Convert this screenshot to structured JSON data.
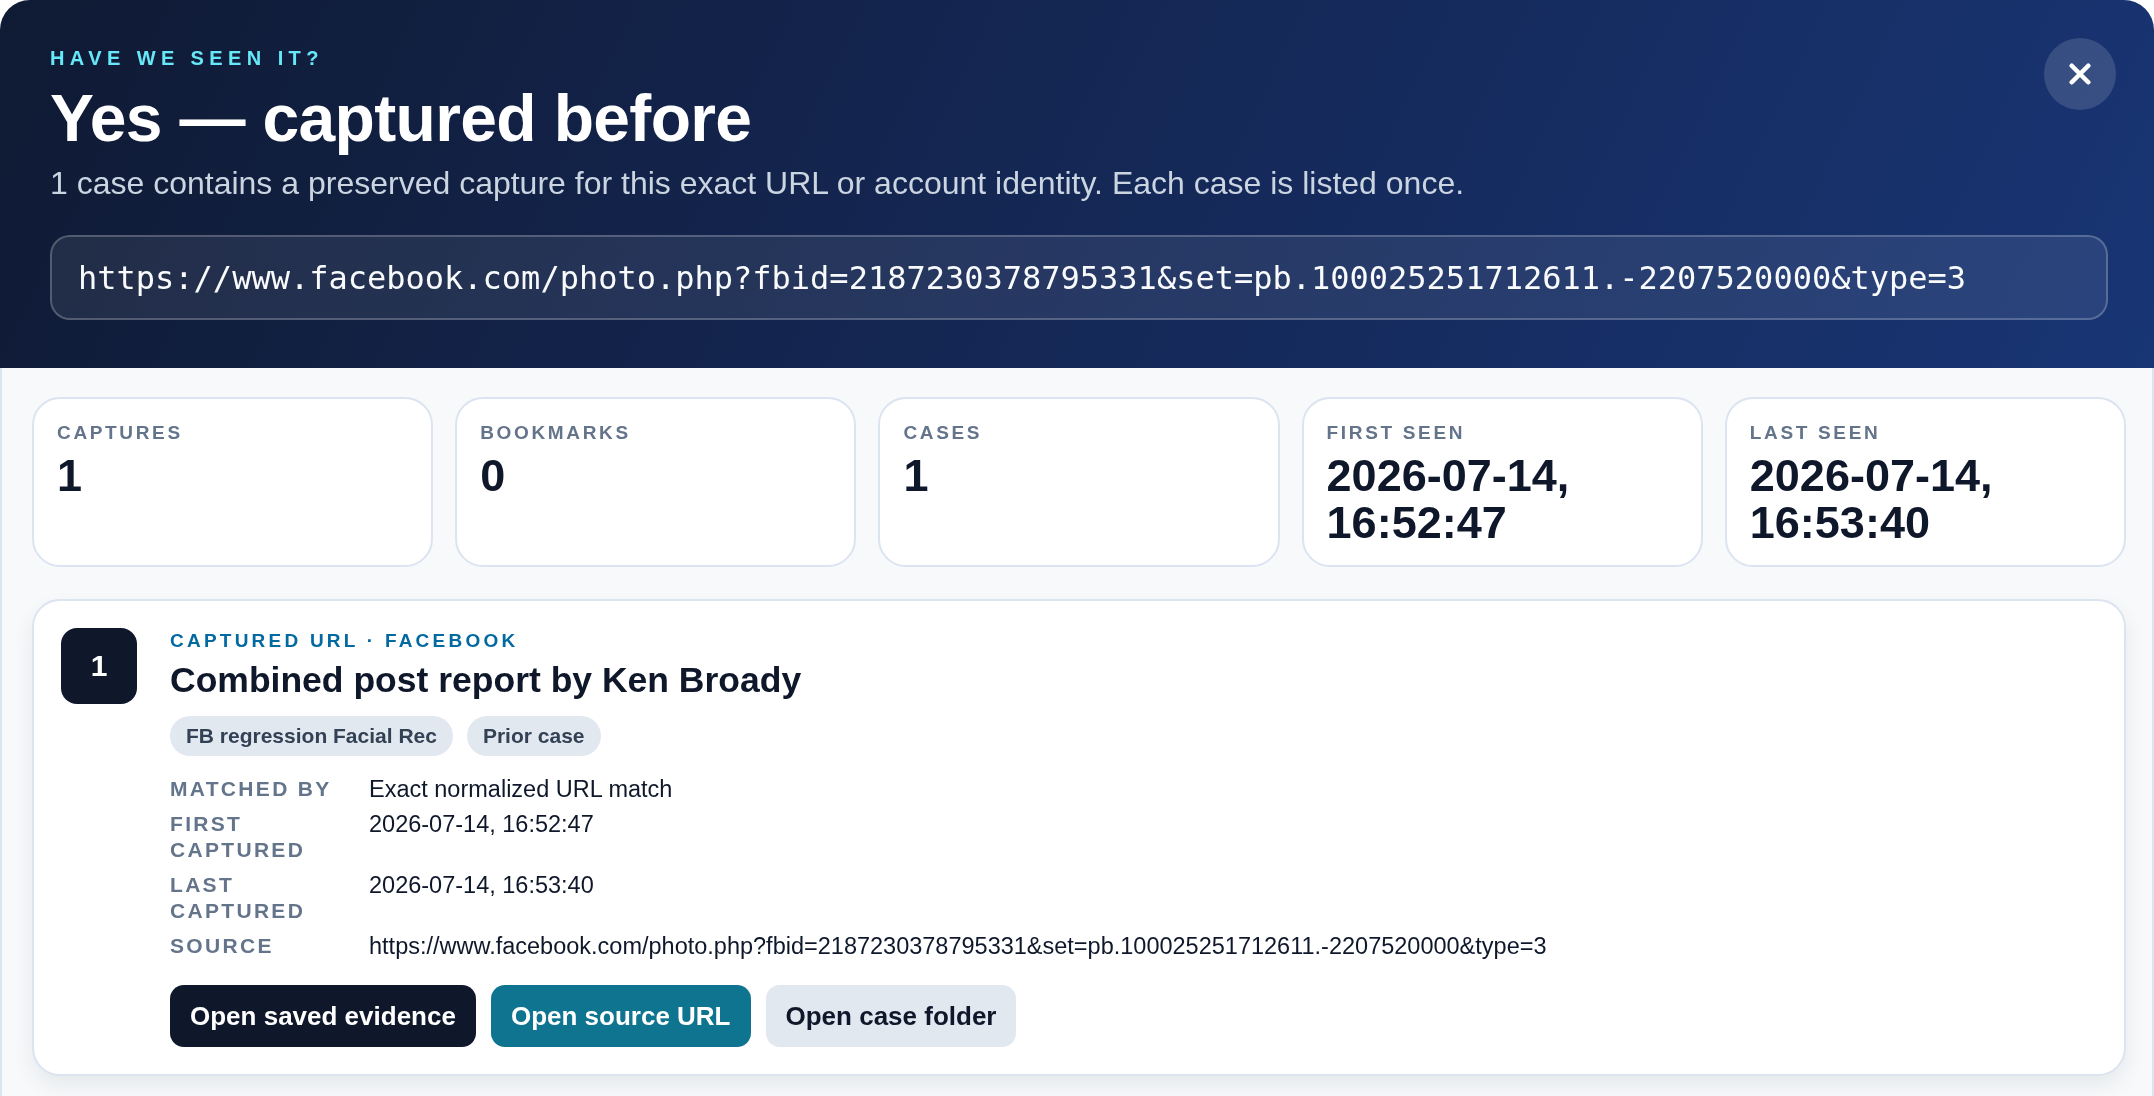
{
  "header": {
    "eyebrow": "HAVE WE SEEN IT?",
    "title": "Yes — captured before",
    "subtitle": "1 case contains a preserved capture for this exact URL or account identity. Each case is listed once.",
    "url": "https://www.facebook.com/photo.php?fbid=2187230378795331&set=pb.100025251712611.-2207520000&type=3"
  },
  "stats": [
    {
      "label": "CAPTURES",
      "value": "1"
    },
    {
      "label": "BOOKMARKS",
      "value": "0"
    },
    {
      "label": "CASES",
      "value": "1"
    },
    {
      "label": "FIRST SEEN",
      "value": "2026-07-14, 16:52:47"
    },
    {
      "label": "LAST SEEN",
      "value": "2026-07-14, 16:53:40"
    }
  ],
  "cases": [
    {
      "number": "1",
      "eyebrow": "CAPTURED URL · FACEBOOK",
      "title": "Combined post report by Ken Broady",
      "tags": [
        "FB regression Facial Rec",
        "Prior case"
      ],
      "details": [
        {
          "label": "MATCHED BY",
          "value": "Exact normalized URL match"
        },
        {
          "label": "FIRST CAPTURED",
          "value": "2026-07-14, 16:52:47"
        },
        {
          "label": "LAST CAPTURED",
          "value": "2026-07-14, 16:53:40"
        },
        {
          "label": "SOURCE",
          "value": "https://www.facebook.com/photo.php?fbid=2187230378795331&set=pb.100025251712611.-2207520000&type=3"
        }
      ],
      "buttons": [
        {
          "label": "Open saved evidence",
          "kind": "primary"
        },
        {
          "label": "Open source URL",
          "kind": "accent"
        },
        {
          "label": "Open case folder",
          "kind": "secondary"
        }
      ]
    }
  ]
}
